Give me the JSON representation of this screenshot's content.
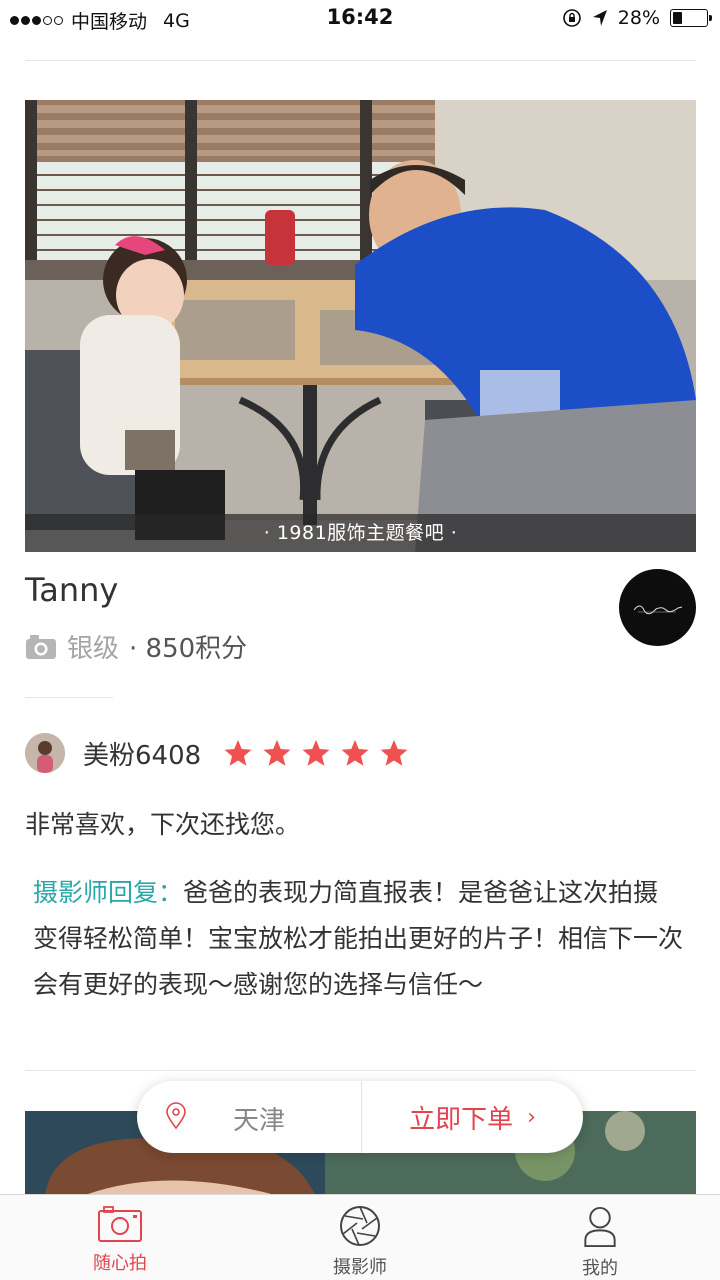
{
  "status_bar": {
    "carrier": "中国移动",
    "network": "4G",
    "time": "16:42",
    "battery": "28%",
    "battery_level": 0.28
  },
  "card": {
    "photo_caption": "· 1981服饰主题餐吧 ·",
    "photographer_name": "Tanny",
    "level": "银级",
    "points": "· 850积分"
  },
  "review": {
    "user_name": "美粉6408",
    "rating": 5,
    "rating_max": 5,
    "text": "非常喜欢，下次还找您。",
    "reply_label": "摄影师回复：",
    "reply_text": "爸爸的表现力简直报表！是爸爸让这次拍摄变得轻松简单！宝宝放松才能拍出更好的片子！相信下一次会有更好的表现～感谢您的选择与信任～"
  },
  "action_bar": {
    "city": "天津",
    "order_label": "立即下单",
    "order_chevron": "›"
  },
  "tabbar": {
    "tabs": [
      {
        "label": "随心拍",
        "icon": "camera-icon",
        "active": true
      },
      {
        "label": "摄影师",
        "icon": "aperture-icon",
        "active": false
      },
      {
        "label": "我的",
        "icon": "user-icon",
        "active": false
      }
    ]
  },
  "colors": {
    "accent": "#e2454f",
    "reply_label": "#2aa7a9",
    "star": "#f05050"
  }
}
